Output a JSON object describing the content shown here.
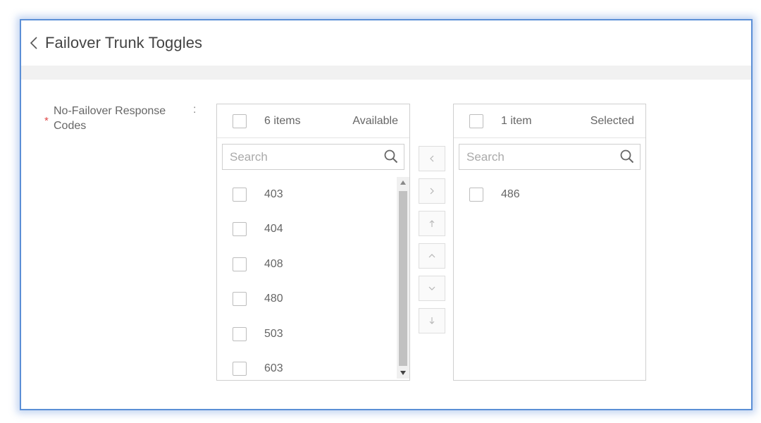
{
  "header": {
    "title": "Failover Trunk Toggles"
  },
  "form": {
    "label": "No-Failover Response Codes",
    "required_mark": "*",
    "colon": ":"
  },
  "available": {
    "count_label": "6 items",
    "title": "Available",
    "search_placeholder": "Search",
    "items": [
      "403",
      "404",
      "408",
      "480",
      "503",
      "603"
    ]
  },
  "selected": {
    "count_label": "1 item",
    "title": "Selected",
    "search_placeholder": "Search",
    "items": [
      "486"
    ]
  },
  "transfer_buttons": [
    "<",
    ">",
    "↑",
    "^",
    "v",
    "↓"
  ],
  "colors": {
    "accent_border": "#5b8fd6",
    "required": "#e04848"
  }
}
